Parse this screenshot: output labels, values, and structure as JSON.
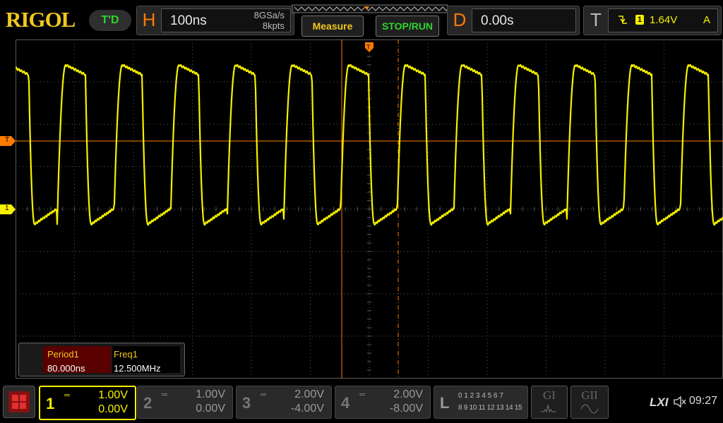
{
  "brand": "RIGOL",
  "trigger_status": "T'D",
  "horizontal": {
    "letter": "H",
    "timebase": "100ns",
    "sample_rate": "8GSa/s",
    "memory_depth": "8kpts"
  },
  "buttons": {
    "measure": "Measure",
    "stop_run": "STOP/RUN"
  },
  "delay": {
    "letter": "D",
    "value": "0.00s"
  },
  "trigger": {
    "letter": "T",
    "source": "1",
    "level": "1.64V",
    "mode": "A"
  },
  "markers": {
    "trigger_level": "T",
    "channel1": "1"
  },
  "measurements": {
    "headers": [
      "Period1",
      "Freq1"
    ],
    "values": [
      "80.000ns",
      "12.500MHz"
    ]
  },
  "channels": [
    {
      "num": "1",
      "scale": "1.00V",
      "offset": "0.00V",
      "active": true
    },
    {
      "num": "2",
      "scale": "1.00V",
      "offset": "0.00V",
      "active": false
    },
    {
      "num": "3",
      "scale": "2.00V",
      "offset": "-4.00V",
      "active": false
    },
    {
      "num": "4",
      "scale": "2.00V",
      "offset": "-8.00V",
      "active": false
    }
  ],
  "logic": {
    "letter": "L",
    "row1": "0 1 2 3  4 5 6 7",
    "row2": "8 9 10 11 12 13 14 15"
  },
  "generators": {
    "g1": "GI",
    "g2": "GII"
  },
  "status": {
    "lxi": "LXI",
    "time": "09:27"
  },
  "colors": {
    "ch1": "#f6f000",
    "trigger": "#ff7a00",
    "grid": "#5a5a5a"
  }
}
